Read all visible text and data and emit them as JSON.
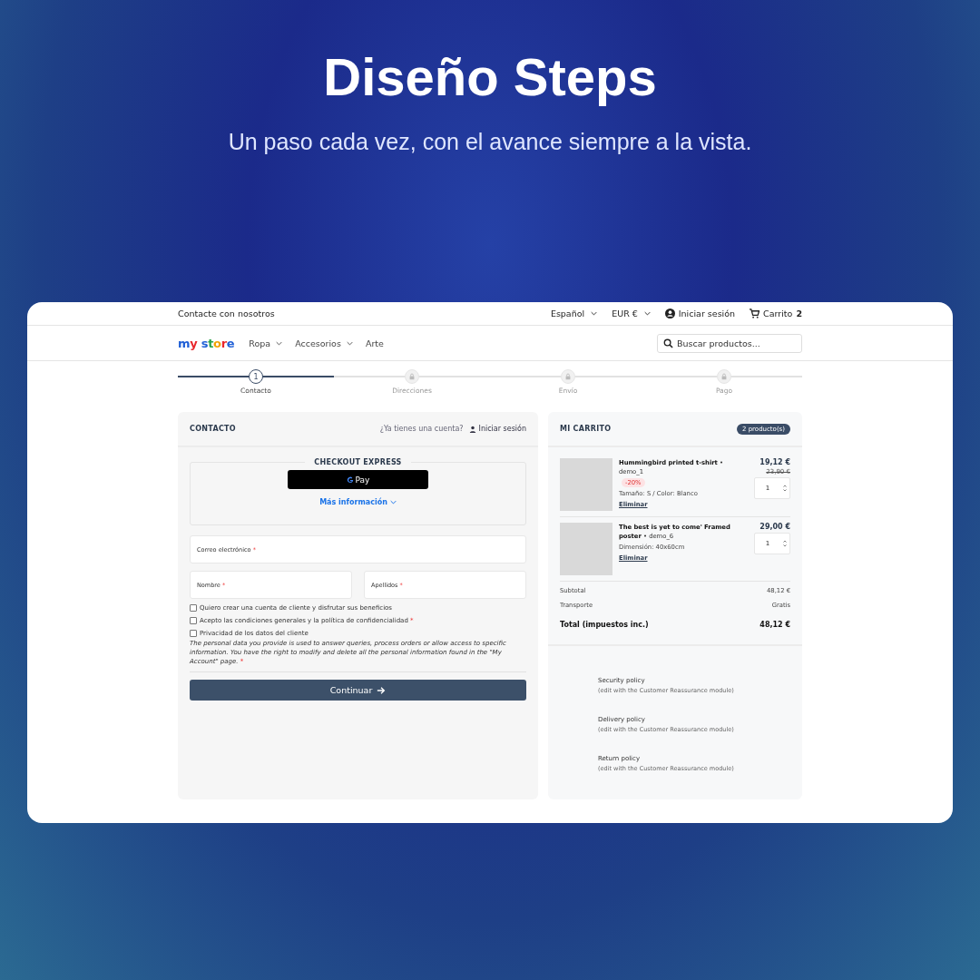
{
  "headline": {
    "title": "Diseño Steps",
    "subtitle": "Un paso cada vez, con el avance siempre a la vista."
  },
  "topbar": {
    "contact": "Contacte con nosotros",
    "language": "Español",
    "currency": "EUR €",
    "login": "Iniciar sesión",
    "cart": "Carrito",
    "cart_count": "2"
  },
  "nav": {
    "logo": "my store",
    "menu": [
      {
        "label": "Ropa",
        "has_dropdown": true
      },
      {
        "label": "Accesorios",
        "has_dropdown": true
      },
      {
        "label": "Arte",
        "has_dropdown": false
      }
    ],
    "search": {
      "placeholder": "Buscar productos..."
    }
  },
  "steps": [
    {
      "label": "Contacto",
      "number": "1",
      "selected": true
    },
    {
      "label": "Direcciones",
      "selected": false
    },
    {
      "label": "Envío",
      "selected": false
    },
    {
      "label": "Pago",
      "selected": false
    }
  ],
  "contact": {
    "title": "CONTACTO",
    "account_question": "¿Ya tienes una cuenta?",
    "login": "Iniciar sesión",
    "express": {
      "title": "CHECKOUT EXPRESS",
      "pay_button": "Pay",
      "more_info": "Más información"
    },
    "field_rows": [
      [
        {
          "label": "Correo electrónico",
          "mark": "*"
        }
      ],
      [
        {
          "label": "Nombre",
          "mark": "*"
        },
        {
          "label": "Apellidos",
          "mark": "*"
        }
      ]
    ],
    "checkboxes": [
      {
        "label": "Quiero crear una cuenta de cliente y disfrutar sus beneficios",
        "checked": false
      },
      {
        "label": "Acepto las condiciones generales y la política de confidencialidad",
        "mark": "*",
        "checked": false
      },
      {
        "label": "Privacidad de los datos del cliente",
        "checked": false,
        "note": "The personal data you provide is used to answer queries, process orders or allow access to specific information. You have the right to modify and delete all the personal information found in the \"My Account\" page.",
        "note_mark": "*"
      }
    ],
    "continue": "Continuar"
  },
  "cart": {
    "title": "MI CARRITO",
    "badge": "2 producto(s)",
    "items": [
      {
        "name": "Hummingbird printed t-shirt",
        "ref": "• demo_1",
        "discount": "-20%",
        "details": "Tamaño: S /  Color: Blanco",
        "remove": "Eliminar",
        "price": "19,12 €",
        "old_price": "23,90 €",
        "quantity": "1"
      },
      {
        "name": "The best is yet to come' Framed poster",
        "ref": "• demo_6",
        "details": "Dimensión: 40x60cm",
        "remove": "Eliminar",
        "price": "29,00 €",
        "quantity": "1"
      }
    ],
    "totals": [
      {
        "label": "Subtotal",
        "value": "48,12 €",
        "kind": "subline"
      },
      {
        "label": "Transporte",
        "value": "Gratis",
        "kind": "subline"
      },
      {
        "label": "Total (impuestos inc.)",
        "value": "48,12 €",
        "kind": "total"
      }
    ],
    "policies": [
      {
        "title": "Security policy",
        "note": "(edit with the Customer Reassurance module)"
      },
      {
        "title": "Delivery policy",
        "note": "(edit with the Customer Reassurance module)"
      },
      {
        "title": "Return policy",
        "note": "(edit with the Customer Reassurance module)"
      }
    ]
  }
}
